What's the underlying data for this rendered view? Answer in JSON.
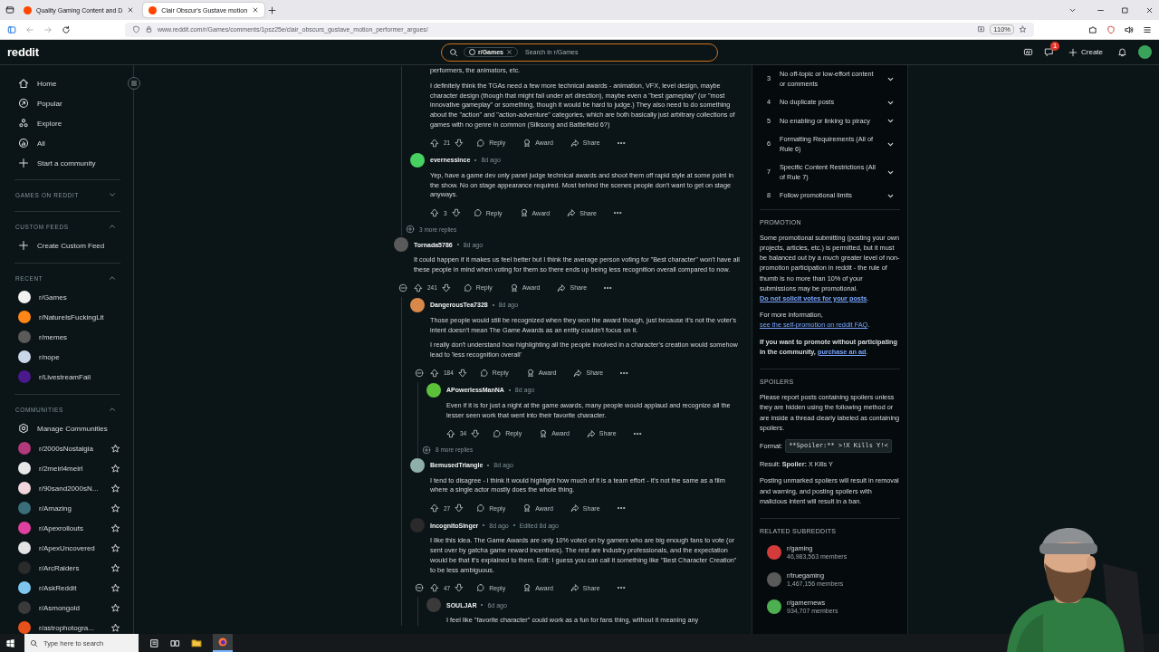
{
  "browser": {
    "tabs": [
      {
        "title": "Quality Gaming Content and D",
        "selected": false
      },
      {
        "title": "Clair Obscur's Gustave motion",
        "selected": true
      }
    ],
    "url": "www.reddit.com/r/Games/comments/1psz25e/clair_obscurs_gustave_motion_performer_argues/",
    "zoom": "110%"
  },
  "header": {
    "logo": "reddit",
    "search": {
      "chip": "r/Games",
      "placeholder": "Search in r/Games"
    },
    "chat_badge": "1",
    "create": "Create"
  },
  "sidebar": {
    "nav": [
      {
        "label": "Home"
      },
      {
        "label": "Popular"
      },
      {
        "label": "Explore"
      },
      {
        "label": "All"
      },
      {
        "label": "Start a community"
      }
    ],
    "sections": [
      {
        "title": "GAMES ON REDDIT",
        "expanded": false
      },
      {
        "title": "CUSTOM FEEDS",
        "expanded": true,
        "items": [
          {
            "kind": "action",
            "label": "Create Custom Feed"
          }
        ]
      },
      {
        "title": "RECENT",
        "expanded": true,
        "items": [
          {
            "kind": "community",
            "label": "r/Games",
            "color": "#f2f2f2"
          },
          {
            "kind": "community",
            "label": "r/NatureIsFuckingLit",
            "color": "#ff8717"
          },
          {
            "kind": "community",
            "label": "r/memes",
            "color": "#5a5a5a"
          },
          {
            "kind": "community",
            "label": "r/nope",
            "color": "#c9d7e8"
          },
          {
            "kind": "community",
            "label": "r/LivestreamFail",
            "color": "#4a1a8c"
          }
        ]
      },
      {
        "title": "COMMUNITIES",
        "expanded": true,
        "items": [
          {
            "kind": "action",
            "label": "Manage Communities"
          },
          {
            "kind": "community",
            "label": "r/2000sNostalgia",
            "color": "#b23a7a",
            "favorite": false
          },
          {
            "kind": "community",
            "label": "r/2meirl4meirl",
            "color": "#e8e8e8",
            "favorite": false
          },
          {
            "kind": "community",
            "label": "r/90sand2000sN...",
            "color": "#f3d6dc",
            "favorite": false
          },
          {
            "kind": "community",
            "label": "r/Amazing",
            "color": "#3a6f7a",
            "favorite": false
          },
          {
            "kind": "community",
            "label": "r/Apexrollouts",
            "color": "#e040a0",
            "favorite": false
          },
          {
            "kind": "community",
            "label": "r/ApexUncovered",
            "color": "#e4e4e4",
            "favorite": false
          },
          {
            "kind": "community",
            "label": "r/ArcRaiders",
            "color": "#2b2b2b",
            "favorite": false
          },
          {
            "kind": "community",
            "label": "r/AskReddit",
            "color": "#7ec8f0",
            "favorite": false
          },
          {
            "kind": "community",
            "label": "r/Asmongold",
            "color": "#3a3a3a",
            "favorite": false
          },
          {
            "kind": "community",
            "label": "r/astrophotogra...",
            "color": "#e8501c",
            "favorite": false
          }
        ]
      }
    ]
  },
  "comments": [
    {
      "children": [
        {
          "paragraphs": [
            "performers, the animators, etc.",
            "I definitely think the TGAs need a few more technical awards - animation, VFX, level design, maybe character design (though that might fall under art direction), maybe even a \"best gameplay\" (or \"most innovative gameplay\" or something, though it would be hard to judge.) They also need to do something about the \"action\" and \"action-adventure\" categories, which are both basically just arbitrary collections of games with no genre in common (Silksong and Battlefield 6?)"
          ],
          "score": "21",
          "actions": [
            "Reply",
            "Award",
            "Share"
          ]
        },
        {
          "author": "evernessince",
          "color": "#46d160",
          "time": "8d ago",
          "paragraphs": [
            "Yep, have a game dev only panel judge technical awards and shoot them off rapid style at some point in the show. No on stage appearance required. Most behind the scenes people don't want to get on stage anyways."
          ],
          "score": "3",
          "actions": [
            "Reply",
            "Award",
            "Share"
          ]
        }
      ],
      "more_replies": "3 more replies"
    },
    {
      "author": "Tornada5786",
      "color": "#5a5a5a",
      "time": "8d ago",
      "paragraphs": [
        "It could happen if it makes us feel better but I think the average person voting for \"Best character\" won't have all these people in mind when voting for them so there ends up being less recognition overall compared to now."
      ],
      "score": "241",
      "expanded": true,
      "actions": [
        "Reply",
        "Award",
        "Share"
      ],
      "children": [
        {
          "author": "DangerousTea7328",
          "color": "#d8894a",
          "time": "8d ago",
          "paragraphs": [
            "Those people would still be recognized when they won the award though, just because it's not the voter's intent doesn't mean The Game Awards as an entity couldn't focus on it.",
            "I really don't understand how highlighting all the people involved in a character's creation would somehow lead to 'less recognition overall'"
          ],
          "score": "184",
          "expanded": true,
          "actions": [
            "Reply",
            "Award",
            "Share"
          ],
          "children": [
            {
              "author": "APowerlessManNA",
              "color": "#5cc13a",
              "time": "8d ago",
              "paragraphs": [
                "Even if it is for just a night at the game awards, many people would applaud and recognize all the lesser seen work that went into their favorite character."
              ],
              "score": "34",
              "actions": [
                "Reply",
                "Award",
                "Share"
              ]
            }
          ],
          "more_replies": "8 more replies"
        },
        {
          "author": "BemusedTriangle",
          "color": "#8fb0a8",
          "time": "8d ago",
          "paragraphs": [
            "I tend to disagree - i think it would highlight how much of it is a team effort - it's not the same as a film where a single actor mostly does the whole thing."
          ],
          "score": "27",
          "actions": [
            "Reply",
            "Award",
            "Share"
          ]
        },
        {
          "author": "IncognitoSinger",
          "color": "#2a2a2a",
          "time": "8d ago",
          "edited": "Edited 8d ago",
          "paragraphs": [
            "I like this idea. The Game Awards are only 10% voted on by gamers who are big enough fans to vote (or sent over by gatcha game reward incentives). The rest are industry professionals, and the expectation would be that it's explained to them. Edit: I guess you can call it something like \"Best Character Creation\" to be less ambiguous."
          ],
          "score": "47",
          "expanded": true,
          "actions": [
            "Reply",
            "Award",
            "Share"
          ],
          "children": [
            {
              "author": "SOULJAR",
              "color": "#3a3a3a",
              "time": "6d ago",
              "paragraphs": [
                "I feel like \"favorite character\" could work as a fun for fans thing, without it meaning any"
              ]
            }
          ]
        }
      ]
    }
  ],
  "aside": [
    {
      "kind": "rules",
      "items": [
        {
          "number": "3",
          "text": "No off-topic or low-effort content or comments",
          "expanded": false
        },
        {
          "number": "4",
          "text": "No duplicate posts",
          "expanded": false
        },
        {
          "number": "5",
          "text": "No enabling or linking to piracy",
          "expanded": false
        },
        {
          "number": "6",
          "text": "Formatting Requirements (All of Rule 6)",
          "expanded": false
        },
        {
          "number": "7",
          "text": "Specific Content Restrictions (All of Rule 7)",
          "expanded": false
        },
        {
          "number": "8",
          "text": "Follow promotional limits",
          "expanded": false
        }
      ]
    },
    {
      "kind": "text",
      "title": "PROMOTION",
      "blocks": [
        {
          "kind": "paragraph",
          "parts": [
            {
              "kind": "text",
              "text": "Some promotional submitting (posting your own projects, articles, etc.) is permitted, but it must be balanced out by a *much* greater level of non-promotion participation in reddit - the rule of thumb is no more than 10% of your submissions may be promotional. "
            },
            {
              "kind": "link",
              "text": "Do not solicit votes for your posts",
              "bold": true
            },
            {
              "kind": "text",
              "text": "."
            }
          ]
        },
        {
          "kind": "paragraph",
          "parts": [
            {
              "kind": "text",
              "text": "For more information, "
            },
            {
              "kind": "link",
              "text": "see the self-promotion on reddit FAQ",
              "bold": false
            },
            {
              "kind": "text",
              "text": "."
            }
          ]
        },
        {
          "kind": "paragraph",
          "parts": [
            {
              "kind": "text",
              "text": "**If you want to promote without participating in the community,** "
            },
            {
              "kind": "link",
              "text": "purchase an ad",
              "bold": true
            },
            {
              "kind": "text",
              "text": "."
            }
          ]
        }
      ]
    },
    {
      "kind": "text",
      "title": "SPOILERS",
      "blocks": [
        {
          "kind": "paragraph",
          "parts": [
            {
              "kind": "text",
              "text": "Please report posts containing spoilers unless they are hidden using the following method or are inside a thread clearly labeled as containing spoilers."
            }
          ]
        },
        {
          "kind": "code",
          "label": "Format:",
          "code": "**Spoiler:** >!X Kills Y!<"
        },
        {
          "kind": "paragraph",
          "parts": [
            {
              "kind": "text",
              "text": "Result: **Spoiler:** X Kills Y"
            }
          ]
        },
        {
          "kind": "paragraph",
          "parts": [
            {
              "kind": "text",
              "text": "Posting unmarked spoilers will result in removal and warning, and posting spoilers with malicious intent will result in a ban."
            }
          ]
        }
      ]
    },
    {
      "kind": "related",
      "title": "RELATED SUBREDDITS",
      "items": [
        {
          "name": "r/gaming",
          "members": "46,983,563 members",
          "color": "#d43b3b"
        },
        {
          "name": "r/truegaming",
          "members": "1,467,156 members",
          "color": "#5a5a5a"
        },
        {
          "name": "r/gamernews",
          "members": "934,707 members",
          "color": "#4caf50"
        }
      ]
    }
  ],
  "taskbar": {
    "search_placeholder": "Type here to search"
  }
}
